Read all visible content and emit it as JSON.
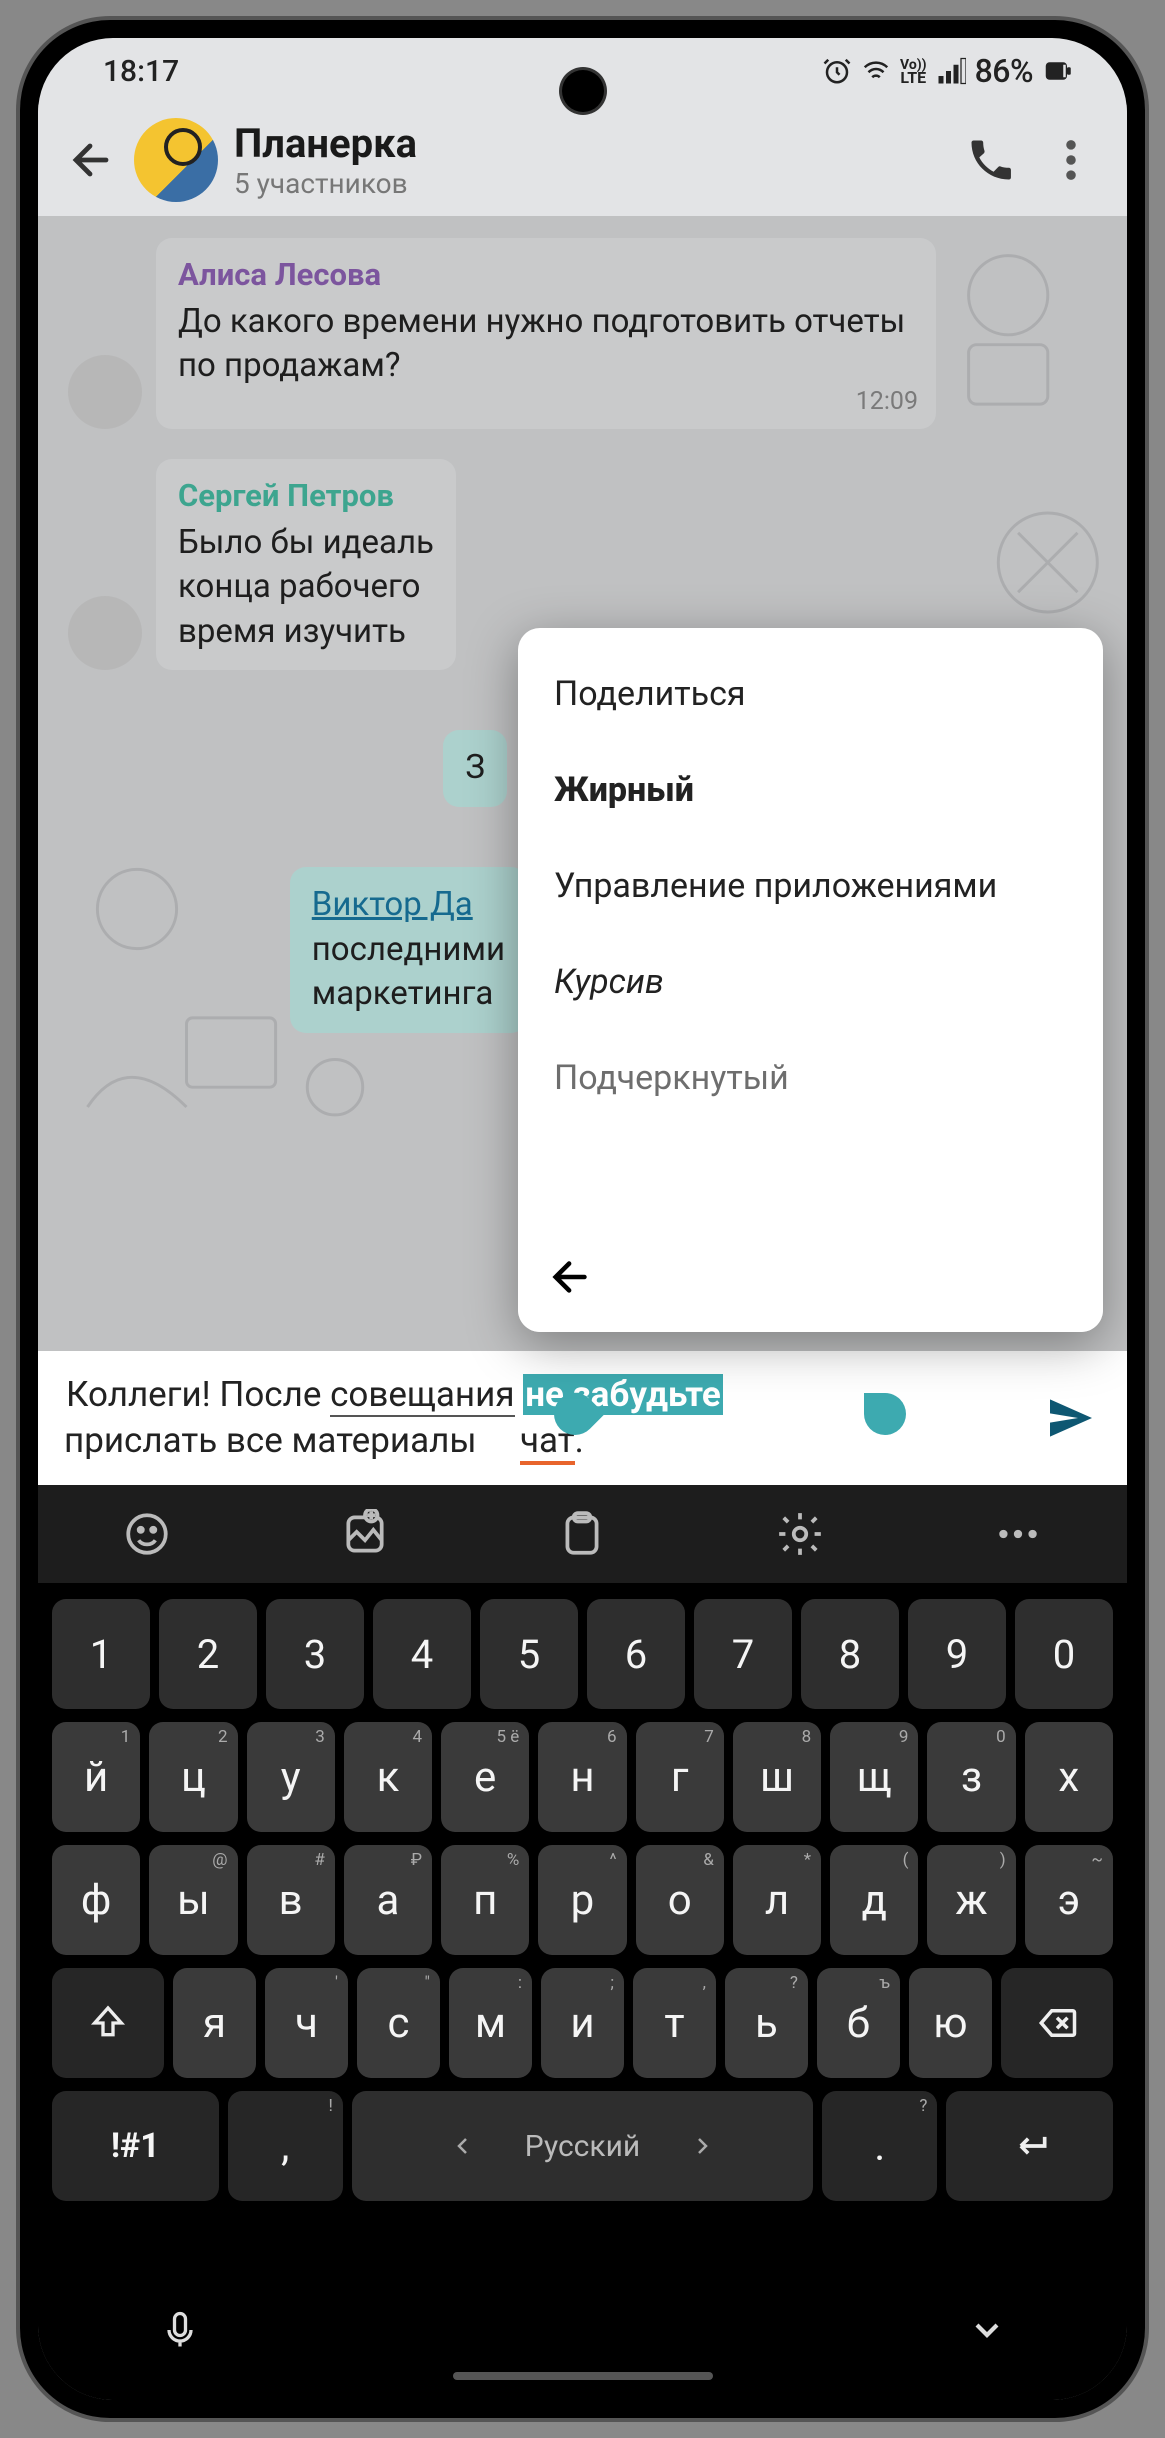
{
  "status": {
    "time": "18:17",
    "battery": "86%",
    "indicators": [
      "alarm",
      "wifi",
      "volte",
      "signal"
    ]
  },
  "header": {
    "title": "Планерка",
    "subtitle": "5 участников"
  },
  "messages": [
    {
      "sender": "Алиса Лесова",
      "sender_class": "sender1",
      "text": "До какого времени нужно подготовить отчеты по продажам?",
      "time": "12:09"
    },
    {
      "sender": "Сергей Петров",
      "sender_class": "sender2",
      "text_partial": "Было бы идеаль\nконца рабочего\nвремя изучить"
    },
    {
      "out": true,
      "text_partial": "З"
    },
    {
      "out": true,
      "link": "Виктор Да",
      "text_partial": "последними\nмаркетинга"
    }
  ],
  "context_menu": {
    "items": [
      {
        "label": "Поделиться",
        "style": ""
      },
      {
        "label": "Жирный",
        "style": "bold"
      },
      {
        "label": "Управление приложениями",
        "style": ""
      },
      {
        "label": "Курсив",
        "style": "italic"
      },
      {
        "label": "Подчеркнутый",
        "style": "cut"
      }
    ]
  },
  "input": {
    "part1": "Коллеги! После ",
    "part2_ul": "совещания",
    "part3": " ",
    "part4_hl": "не забудьте",
    "part5": " прислать все материалы ",
    "part6_err_cut": "чат",
    "part7": "."
  },
  "keyboard": {
    "lang": "Русский",
    "sym": "!#1",
    "rows": {
      "nums": [
        "1",
        "2",
        "3",
        "4",
        "5",
        "6",
        "7",
        "8",
        "9",
        "0"
      ],
      "r1": [
        [
          "й",
          "1"
        ],
        [
          "ц",
          "2"
        ],
        [
          "у",
          "3"
        ],
        [
          "к",
          "4"
        ],
        [
          "е",
          "5  ё"
        ],
        [
          "н",
          "6"
        ],
        [
          "г",
          "7"
        ],
        [
          "ш",
          "8"
        ],
        [
          "щ",
          "9"
        ],
        [
          "з",
          "0"
        ],
        [
          "х",
          ""
        ]
      ],
      "r2": [
        [
          "ф",
          ""
        ],
        [
          "ы",
          "@"
        ],
        [
          "в",
          "#"
        ],
        [
          "а",
          "₽"
        ],
        [
          "п",
          "%"
        ],
        [
          "р",
          "^"
        ],
        [
          "о",
          "&"
        ],
        [
          "л",
          "*"
        ],
        [
          "д",
          "("
        ],
        [
          "ж",
          ")"
        ],
        [
          "э",
          "~"
        ]
      ],
      "r3": [
        [
          "я",
          ""
        ],
        [
          "ч",
          "'"
        ],
        [
          "с",
          "\""
        ],
        [
          "м",
          ":"
        ],
        [
          "и",
          ";"
        ],
        [
          "т",
          ","
        ],
        [
          "ь",
          "?"
        ],
        [
          "б",
          "ъ"
        ],
        [
          "ю",
          ""
        ]
      ]
    },
    "comma_sup": "!",
    "dot_sup": "?"
  }
}
